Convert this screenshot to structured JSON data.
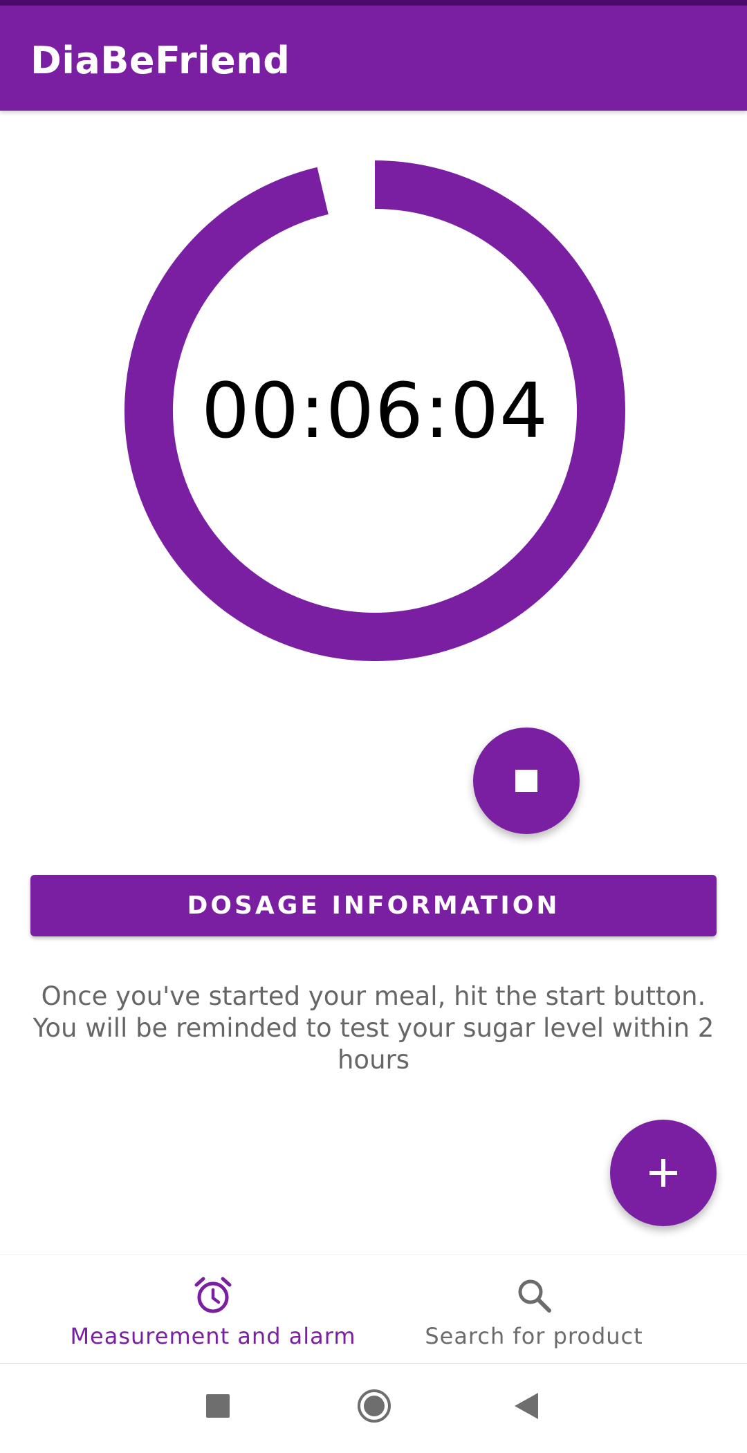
{
  "app_bar": {
    "title": "DiaBeFriend"
  },
  "timer": {
    "display": "00:06:04",
    "progress_fraction": 0.963
  },
  "actions": {
    "dosage_label": "DOSAGE INFORMATION"
  },
  "instructions": {
    "text": "Once you've started your meal, hit the start button. You will be reminded to test your sugar level within 2 hours"
  },
  "bottom_nav": {
    "items": [
      {
        "label": "Measurement and alarm",
        "icon": "alarm-clock-icon",
        "active": true
      },
      {
        "label": "Search for product",
        "icon": "search-icon",
        "active": false
      }
    ]
  },
  "colors": {
    "primary": "#7b1fa2",
    "primary_dark": "#4a0a6b",
    "inactive": "#6b6b6b"
  },
  "system_nav": {
    "icons": [
      "recent-apps-icon",
      "home-icon",
      "back-icon"
    ]
  }
}
